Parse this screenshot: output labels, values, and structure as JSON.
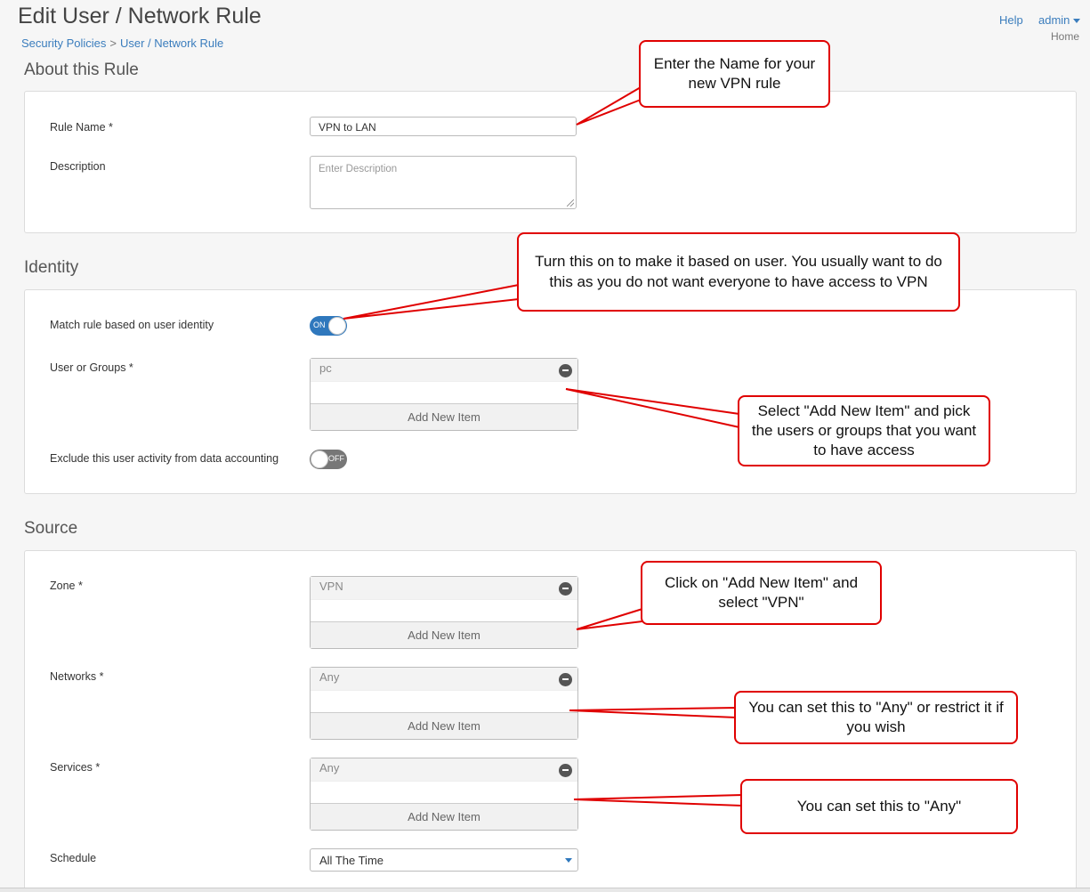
{
  "header": {
    "title": "Edit User / Network Rule",
    "breadcrumb": {
      "parent": "Security Policies",
      "separator": ">",
      "current": "User / Network Rule"
    },
    "help": "Help",
    "user": "admin",
    "home": "Home"
  },
  "about": {
    "section_title": "About this Rule",
    "rule_name_label": "Rule Name *",
    "rule_name_value": "VPN to LAN",
    "description_label": "Description",
    "description_placeholder": "Enter Description"
  },
  "identity": {
    "section_title": "Identity",
    "match_label": "Match rule based on user identity",
    "match_toggle": "ON",
    "users_label": "User or Groups *",
    "users_item": "pc",
    "users_add": "Add New Item",
    "exclude_label": "Exclude this user activity from data accounting",
    "exclude_toggle": "OFF"
  },
  "source": {
    "section_title": "Source",
    "zone_label": "Zone *",
    "zone_item": "VPN",
    "zone_add": "Add New Item",
    "networks_label": "Networks *",
    "networks_item": "Any",
    "networks_add": "Add New Item",
    "services_label": "Services *",
    "services_item": "Any",
    "services_add": "Add New Item",
    "schedule_label": "Schedule",
    "schedule_value": "All The Time"
  },
  "callouts": {
    "name": "Enter the Name for your new VPN rule",
    "identity": "Turn this on to make it based on user.  You usually want to do this as you do not want everyone to have access to VPN",
    "users": "Select \"Add New Item\" and pick the users or groups that you want to have access",
    "zone": "Click on \"Add New Item\" and select \"VPN\"",
    "networks": "You can set this to \"Any\" or restrict it if you wish",
    "services": "You can set this to \"Any\""
  },
  "colors": {
    "accent": "#2f78bd",
    "callout_border": "#e00000",
    "link": "#3b7dbd"
  }
}
